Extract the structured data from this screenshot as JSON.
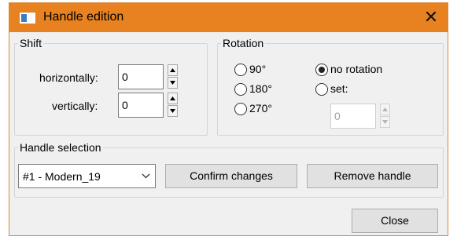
{
  "window": {
    "title": "Handle edition",
    "close_glyph": "✕",
    "accent": "#e8811f"
  },
  "shift": {
    "legend": "Shift",
    "horizontally_label": "horizontally:",
    "horizontally_value": "0",
    "vertically_label": "vertically:",
    "vertically_value": "0"
  },
  "rotation": {
    "legend": "Rotation",
    "options": [
      "90°",
      "180°",
      "270°",
      "no rotation",
      "set:"
    ],
    "selected": "no rotation",
    "set_value": "0"
  },
  "handle_selection": {
    "legend": "Handle selection",
    "selected": "#1 - Modern_19",
    "confirm_label": "Confirm changes",
    "remove_label": "Remove handle"
  },
  "footer": {
    "close_label": "Close"
  }
}
